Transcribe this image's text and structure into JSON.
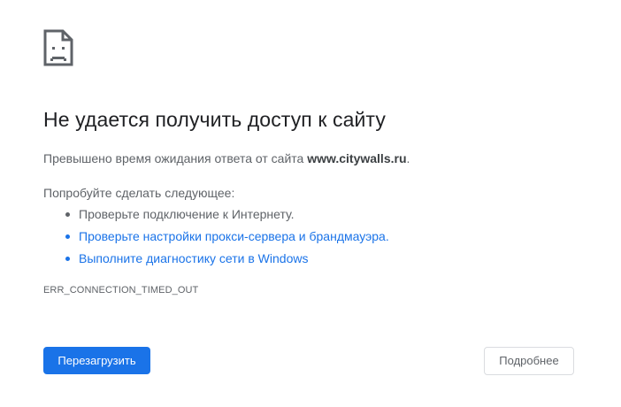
{
  "error_icon": "sad-page-icon",
  "title": "Не удается получить доступ к сайту",
  "summary": {
    "prefix": "Превышено время ожидания ответа от сайта ",
    "host": "www.citywalls.ru",
    "suffix": "."
  },
  "suggestions": {
    "heading": "Попробуйте сделать следующее:",
    "items": [
      {
        "text": "Проверьте подключение к Интернету.",
        "is_link": false
      },
      {
        "link_text": "Проверьте настройки прокси-сервера и брандмауэра",
        "suffix": ".",
        "is_link": true
      },
      {
        "link_text": "Выполните диагностику сети в Windows",
        "is_link": true
      }
    ]
  },
  "error_code": "ERR_CONNECTION_TIMED_OUT",
  "buttons": {
    "reload_label": "Перезагрузить",
    "details_label": "Подробнее"
  },
  "colors": {
    "accent": "#1a73e8",
    "title": "#202124",
    "body_text": "#5f6368",
    "button_border": "#dadce0"
  }
}
